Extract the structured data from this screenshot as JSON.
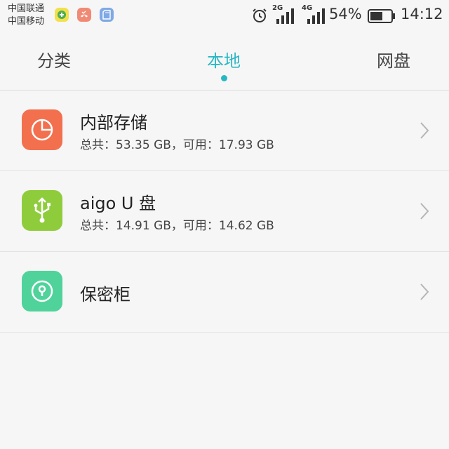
{
  "status_bar": {
    "carrier_1": "中国联通",
    "carrier_2": "中国移动",
    "network_1": "2G",
    "network_2": "4G",
    "battery_percent": "54%",
    "time": "14:12",
    "notification_icons": [
      "app-icon",
      "phone-missed-icon",
      "sd-card-icon"
    ]
  },
  "tabs": [
    {
      "label": "分类",
      "active": false
    },
    {
      "label": "本地",
      "active": true
    },
    {
      "label": "网盘",
      "active": false
    }
  ],
  "storage_items": [
    {
      "title": "内部存储",
      "detail": "总共：53.35 GB，可用：17.93 GB",
      "icon": "pie-chart-icon",
      "color": "#f2704e"
    },
    {
      "title": "aigo U 盘",
      "detail": "总共：14.91 GB，可用：14.62 GB",
      "icon": "usb-icon",
      "color": "#8fcc3c"
    },
    {
      "title": "保密柜",
      "detail": "",
      "icon": "lock-icon",
      "color": "#4fd39a"
    }
  ],
  "accent_color": "#2ab7c4"
}
